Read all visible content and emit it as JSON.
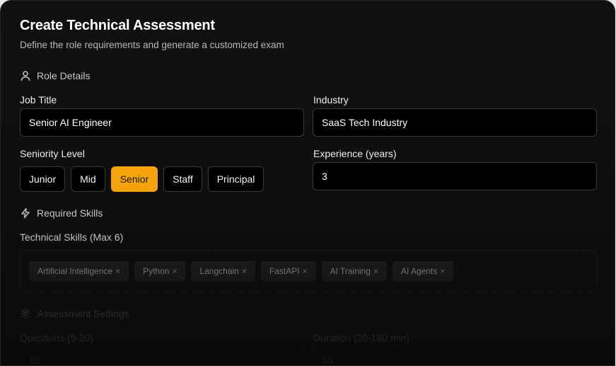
{
  "header": {
    "title": "Create Technical Assessment",
    "subtitle": "Define the role requirements and generate a customized exam"
  },
  "role_details": {
    "heading": "Role Details",
    "icon": "user-icon",
    "job_title": {
      "label": "Job Title",
      "value": "Senior AI Engineer"
    },
    "industry": {
      "label": "Industry",
      "value": "SaaS Tech Industry"
    },
    "seniority": {
      "label": "Seniority Level",
      "options": [
        "Junior",
        "Mid",
        "Senior",
        "Staff",
        "Principal"
      ],
      "selected": "Senior"
    },
    "experience": {
      "label": "Experience (years)",
      "value": "3"
    }
  },
  "skills": {
    "heading": "Required Skills",
    "icon": "lightning-icon",
    "label": "Technical Skills (Max 6)",
    "items": [
      "Artificial Intelligence",
      "Python",
      "Langchain",
      "FastAPI",
      "AI Training",
      "AI Agents"
    ],
    "remove_glyph": "×"
  },
  "assessment": {
    "heading": "Assessment Settings",
    "icon": "gear-icon",
    "questions": {
      "label": "Questions (5-20)",
      "value": "15"
    },
    "duration": {
      "label": "Duration (20-180 min)",
      "value": "60"
    }
  },
  "colors": {
    "accent": "#f5a30a",
    "background": "#0f0f0f",
    "input_bg": "#000000"
  }
}
